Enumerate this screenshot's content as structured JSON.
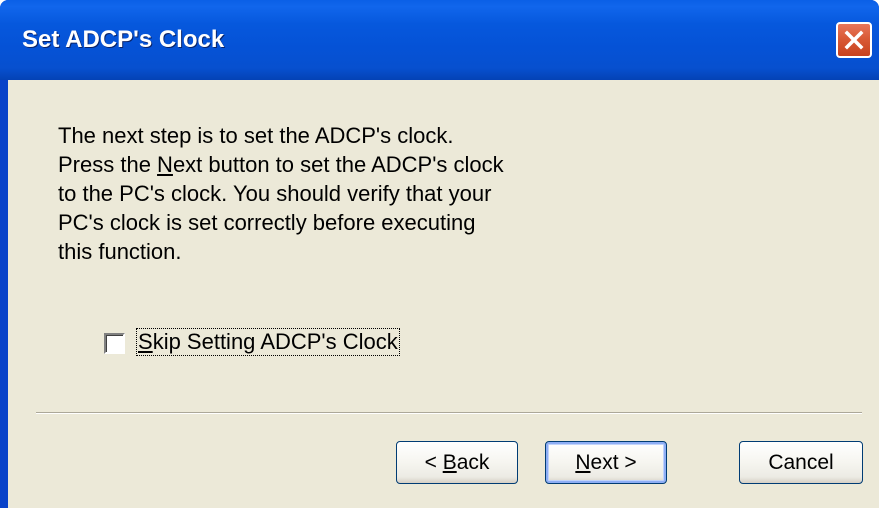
{
  "window": {
    "title": "Set ADCP's Clock"
  },
  "titlebar": {
    "close_icon": "close-icon"
  },
  "body": {
    "lines": [
      "The next step is to set the ADCP's clock.",
      [
        "Press the ",
        "N",
        "ext button to set the ADCP's clock"
      ],
      "to the PC's clock.  You should verify that your",
      "PC's clock is set correctly before executing",
      "this function."
    ],
    "line_0": "The next step is to set the ADCP's clock.",
    "line_1_pre": "Press the ",
    "line_1_mnemonic": "N",
    "line_1_post": "ext button to set the ADCP's clock",
    "line_2": "to the PC's clock.  You should verify that your",
    "line_3": "PC's clock is set correctly before executing",
    "line_4": "this function."
  },
  "skip_checkbox": {
    "checked": false,
    "label_mnemonic": "S",
    "label_rest": "kip Setting ADCP's Clock"
  },
  "buttons": {
    "back_prefix": "< ",
    "back_mnemonic": "B",
    "back_rest": "ack",
    "next_mnemonic": "N",
    "next_rest": "ext >",
    "cancel_label": "Cancel"
  },
  "colors": {
    "titlebar": "#0552d6",
    "client_background": "#ece9d8",
    "close_button": "#d95a36"
  }
}
